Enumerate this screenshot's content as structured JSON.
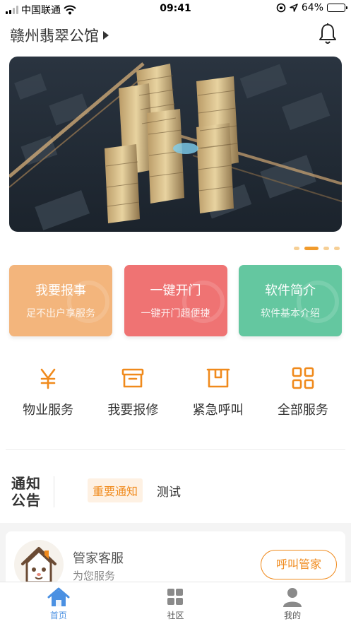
{
  "status_bar": {
    "carrier": "中国联通",
    "time": "09:41",
    "battery_percent": "64%",
    "battery_level": 0.64
  },
  "header": {
    "location": "赣州翡翠公馆",
    "bell_icon": "bell-icon"
  },
  "banner": {
    "slide_count": 4,
    "active_index": 1
  },
  "quick_cards": [
    {
      "title": "我要报事",
      "subtitle": "足不出户享服务",
      "color": "#f3b57c"
    },
    {
      "title": "一键开门",
      "subtitle": "一键开门超便捷",
      "color": "#ef7373"
    },
    {
      "title": "软件简介",
      "subtitle": "软件基本介绍",
      "color": "#64c7a0"
    }
  ],
  "services": [
    {
      "label": "物业服务",
      "icon": "yen-icon"
    },
    {
      "label": "我要报修",
      "icon": "toolbox-icon"
    },
    {
      "label": "紧急呼叫",
      "icon": "alert-box-icon"
    },
    {
      "label": "全部服务",
      "icon": "grid-icon"
    }
  ],
  "notice": {
    "logo_line1": "通知",
    "logo_line2": "公告",
    "tag": "重要通知",
    "text": "测试"
  },
  "butler": {
    "title": "管家客服",
    "subtitle": "为您服务",
    "button": "呼叫管家"
  },
  "tabbar": [
    {
      "label": "首页",
      "icon": "home-icon",
      "active": true
    },
    {
      "label": "社区",
      "icon": "community-grid-icon",
      "active": false
    },
    {
      "label": "我的",
      "icon": "user-icon",
      "active": false
    }
  ],
  "colors": {
    "accent": "#f08a1c",
    "tab_active": "#4a90e2"
  }
}
